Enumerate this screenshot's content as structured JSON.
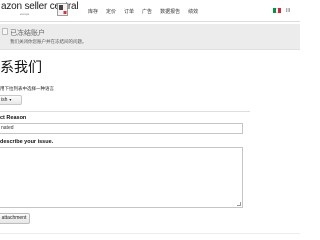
{
  "header": {
    "brand": "azon seller central",
    "brand_sub": "europe",
    "nav": [
      "库存",
      "定价",
      "订单",
      "广告",
      "数据报告",
      "绩效"
    ],
    "flag_colors": [
      "#009246",
      "#ffffff",
      "#ce2b37"
    ],
    "top_right": "III"
  },
  "notice": {
    "title": "已冻结账户",
    "text": "我们关闭你您账户并在冻结间的问题。"
  },
  "page": {
    "title": "系我们"
  },
  "language": {
    "label": "用下拉列表中选择一种语言",
    "selected": "ish"
  },
  "form": {
    "reason_label": "ct Reason",
    "reason_value": "nated",
    "issue_label": "describe your issue.",
    "attach_button": "attachment"
  }
}
